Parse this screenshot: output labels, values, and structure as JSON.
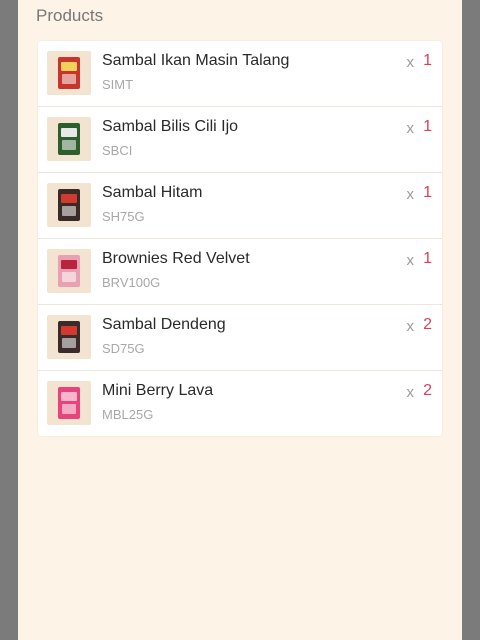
{
  "section": {
    "title": "Products"
  },
  "qty_prefix": "x",
  "products": [
    {
      "name": "Sambal Ikan Masin Talang",
      "sku": "SIMT",
      "qty": "1",
      "icon": "sambal-jar-icon",
      "pack_color": "#c8352b",
      "label_color": "#f2d25a"
    },
    {
      "name": "Sambal Bilis Cili Ijo",
      "sku": "SBCI",
      "qty": "1",
      "icon": "sambal-jar-icon",
      "pack_color": "#2f5e2e",
      "label_color": "#e8e8e8"
    },
    {
      "name": "Sambal Hitam",
      "sku": "SH75G",
      "qty": "1",
      "icon": "sambal-jar-icon",
      "pack_color": "#3a2a26",
      "label_color": "#d23a2f"
    },
    {
      "name": "Brownies Red Velvet",
      "sku": "BRV100G",
      "qty": "1",
      "icon": "brownies-box-icon",
      "pack_color": "#e9a0b2",
      "label_color": "#b8243e"
    },
    {
      "name": "Sambal Dendeng",
      "sku": "SD75G",
      "qty": "2",
      "icon": "sambal-jar-icon",
      "pack_color": "#3b2b2a",
      "label_color": "#d23a2f"
    },
    {
      "name": "Mini Berry Lava",
      "sku": "MBL25G",
      "qty": "2",
      "icon": "berry-pack-icon",
      "pack_color": "#e8437a",
      "label_color": "#f7b6cb"
    }
  ]
}
